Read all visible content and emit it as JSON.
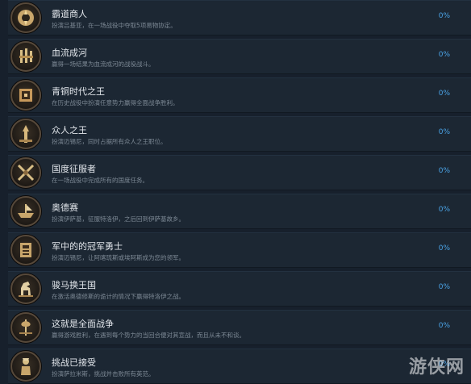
{
  "achievements": [
    {
      "title": "霸道商人",
      "description": "扮演吕基亚，在一场战役中夺取5项易物协定。",
      "percent": "0%",
      "icon": "merchant-icon"
    },
    {
      "title": "血流成河",
      "description": "赢得一场结果为血流成河的战役战斗。",
      "percent": "0%",
      "icon": "bloodbath-icon"
    },
    {
      "title": "青铜时代之王",
      "description": "在历史战役中扮演任意势力赢得全面战争胜利。",
      "percent": "0%",
      "icon": "bronze-age-icon"
    },
    {
      "title": "众人之王",
      "description": "扮演迈锡尼，同时占据所有众人之王职位。",
      "percent": "0%",
      "icon": "king-of-men-icon"
    },
    {
      "title": "国度征服者",
      "description": "在一场战役中完成所有的国度任务。",
      "percent": "0%",
      "icon": "crossed-swords-icon"
    },
    {
      "title": "奥德赛",
      "description": "扮演伊萨基，征服特洛伊，之后回到伊萨基故乡。",
      "percent": "0%",
      "icon": "ship-icon"
    },
    {
      "title": "军中的的冠军勇士",
      "description": "扮演迈锡尼，让阿喀琉斯或埃阿斯成为您的领军。",
      "percent": "0%",
      "icon": "champion-icon"
    },
    {
      "title": "骏马换王国",
      "description": "在激活奥德修斯的诡计的情况下赢得特洛伊之战。",
      "percent": "0%",
      "icon": "horse-icon"
    },
    {
      "title": "这就是全面战争",
      "description": "赢得游戏胜利，在遇到每个势力的当回合便对其宣战，而且从未不和谈。",
      "percent": "0%",
      "icon": "axes-icon"
    },
    {
      "title": "挑战已接受",
      "description": "扮演萨拉米斯，挑战并击败所有英范。",
      "percent": "0%",
      "icon": "warrior-icon"
    }
  ],
  "watermark": "游侠网"
}
